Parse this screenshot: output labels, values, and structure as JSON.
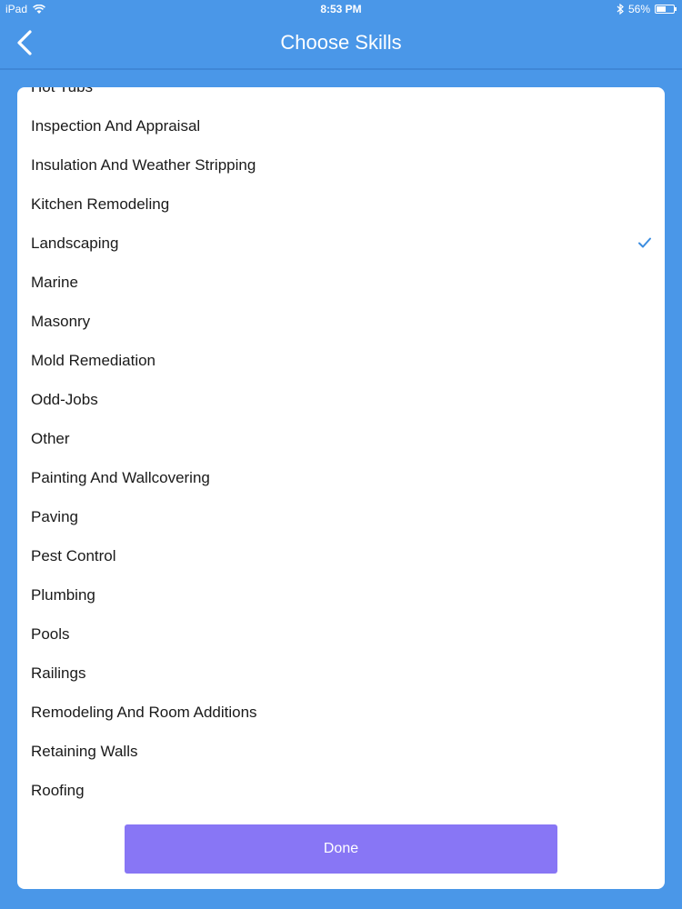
{
  "status_bar": {
    "device": "iPad",
    "time": "8:53 PM",
    "battery_percent": "56%",
    "battery_level": 0.56,
    "icons": [
      "wifi-icon",
      "bluetooth-icon",
      "battery-icon"
    ]
  },
  "nav": {
    "title": "Choose Skills",
    "back_icon": "chevron-left-icon"
  },
  "skills": [
    {
      "label": "Hot Tubs",
      "checked": false
    },
    {
      "label": "Inspection And Appraisal",
      "checked": false
    },
    {
      "label": "Insulation And Weather Stripping",
      "checked": false
    },
    {
      "label": "Kitchen Remodeling",
      "checked": false
    },
    {
      "label": "Landscaping",
      "checked": true
    },
    {
      "label": "Marine",
      "checked": false
    },
    {
      "label": "Masonry",
      "checked": false
    },
    {
      "label": "Mold Remediation",
      "checked": false
    },
    {
      "label": "Odd-Jobs",
      "checked": false
    },
    {
      "label": "Other",
      "checked": false
    },
    {
      "label": "Painting And Wallcovering",
      "checked": false
    },
    {
      "label": "Paving",
      "checked": false
    },
    {
      "label": "Pest Control",
      "checked": false
    },
    {
      "label": "Plumbing",
      "checked": false
    },
    {
      "label": "Pools",
      "checked": false
    },
    {
      "label": "Railings",
      "checked": false
    },
    {
      "label": "Remodeling And Room Additions",
      "checked": false
    },
    {
      "label": "Retaining Walls",
      "checked": false
    },
    {
      "label": "Roofing",
      "checked": false
    }
  ],
  "done_label": "Done",
  "colors": {
    "background": "#4a97e8",
    "card": "#ffffff",
    "done_button": "#8876f5",
    "checkmark": "#3b8de0",
    "text": "#1a1a1a"
  }
}
